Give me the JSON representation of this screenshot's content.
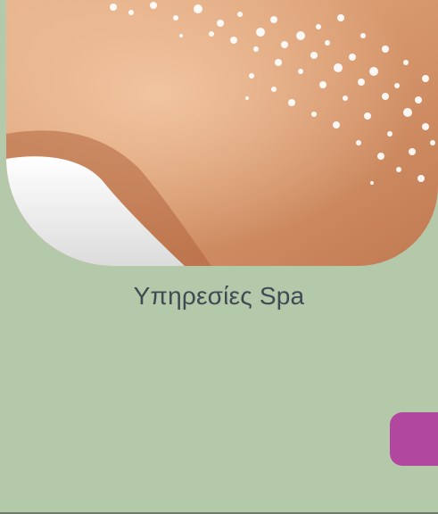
{
  "hero": {
    "image": "spa-salt-massage-photo"
  },
  "caption": {
    "text": "Υπηρεσίες Spa"
  },
  "colors": {
    "background": "#b4c8aa",
    "caption_text": "#3f4a52",
    "side_tab": "#b1479f"
  }
}
